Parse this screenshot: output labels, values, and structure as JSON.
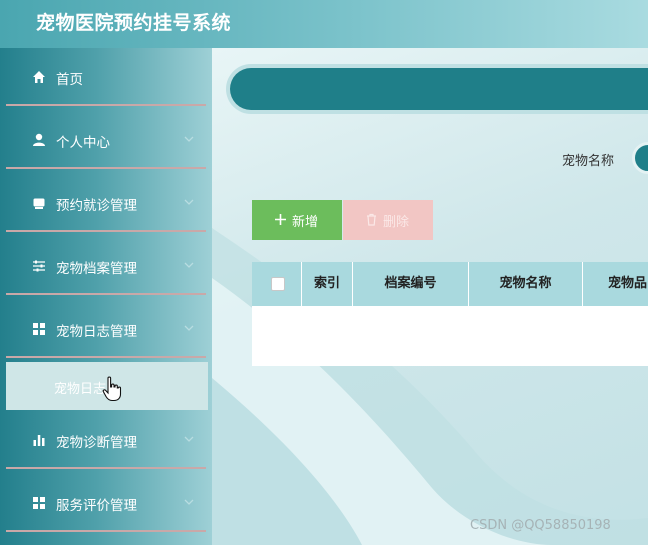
{
  "header": {
    "title": "宠物医院预约挂号系统"
  },
  "sidebar": {
    "items": [
      {
        "label": "首页"
      },
      {
        "label": "个人中心"
      },
      {
        "label": "预约就诊管理"
      },
      {
        "label": "宠物档案管理"
      },
      {
        "label": "宠物日志管理"
      },
      {
        "label": "宠物诊断管理"
      },
      {
        "label": "服务评价管理"
      }
    ],
    "submenu": {
      "label": "宠物日志"
    }
  },
  "search": {
    "label": "宠物名称"
  },
  "toolbar": {
    "add_label": "新增",
    "delete_label": "删除"
  },
  "table": {
    "columns": [
      "索引",
      "档案编号",
      "宠物名称",
      "宠物品"
    ]
  },
  "watermark": "CSDN @QQ58850198",
  "colors": {
    "header": "#4aa6b0",
    "sidebar": "#237f8c",
    "accent": "#1f7f89",
    "add": "#6cbd5c",
    "delete": "#f2c6c4"
  }
}
